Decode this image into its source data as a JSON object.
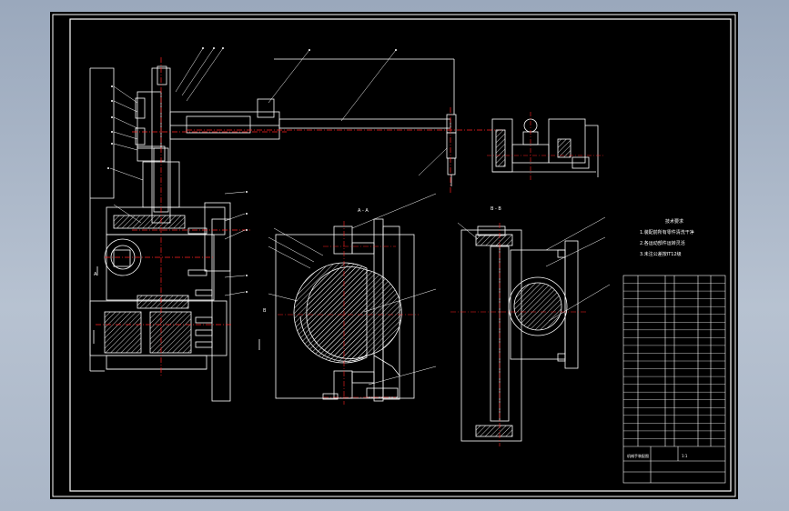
{
  "section_labels": {
    "a1": "A",
    "a2": "A",
    "b1": "B",
    "b2": "B",
    "section_aa": "A - A",
    "section_bb": "B - B"
  },
  "tech_notes": [
    "技术要求",
    "1.装配前所有零件清洗干净",
    "2.各运动部件运转灵活",
    "3.未注公差按IT12级"
  ],
  "bom_rows": [
    "",
    "",
    "",
    "",
    "",
    "",
    "",
    "",
    "",
    "",
    "",
    "",
    "",
    "",
    "",
    "",
    "",
    "",
    "",
    "",
    "",
    ""
  ],
  "title_block": {
    "name": "机械手装配图",
    "scale": "1:1"
  },
  "colors": {
    "paper": "#000000",
    "outline": "#ffffff",
    "centerline": "#ff2020",
    "hatch": "#ffffff",
    "leader": "#ffffff"
  }
}
